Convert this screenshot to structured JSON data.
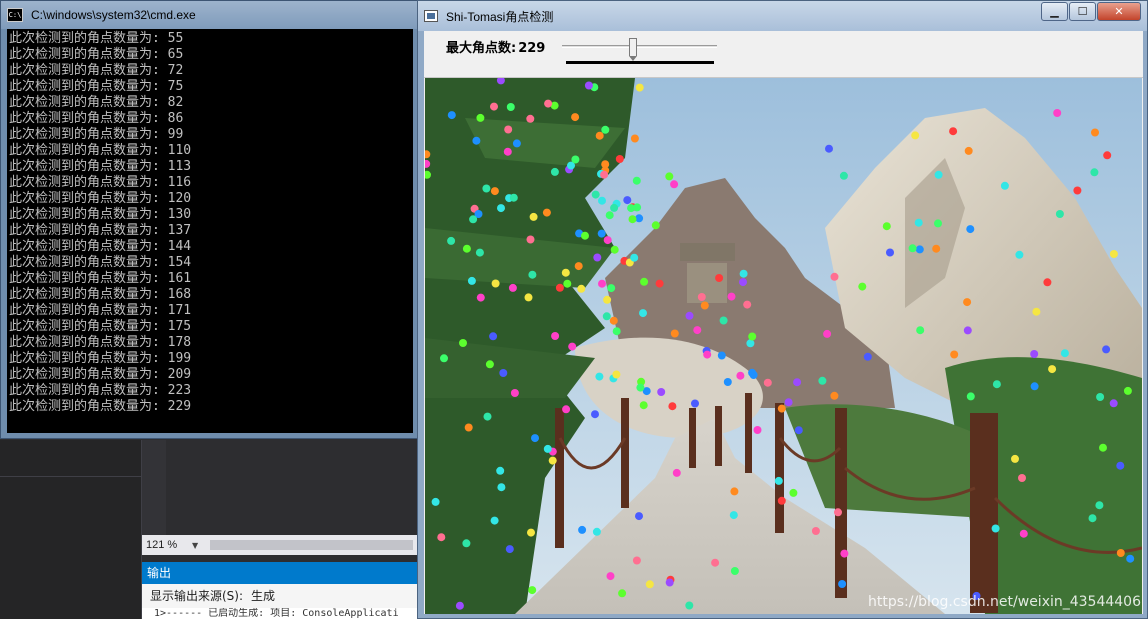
{
  "ide": {
    "zoom": "121 %",
    "output_panel_title": "输出",
    "show_output_from_label": "显示输出来源(S):",
    "show_output_from_value": "生成",
    "output_text": "1>------ 已启动生成: 项目: ConsoleApplicati"
  },
  "cmd": {
    "title": "C:\\windows\\system32\\cmd.exe",
    "icon": "cmd-icon",
    "lines": [
      "此次检测到的角点数量为: 55",
      "此次检测到的角点数量为: 65",
      "此次检测到的角点数量为: 72",
      "此次检测到的角点数量为: 75",
      "此次检测到的角点数量为: 82",
      "此次检测到的角点数量为: 86",
      "此次检测到的角点数量为: 99",
      "此次检测到的角点数量为: 110",
      "此次检测到的角点数量为: 113",
      "此次检测到的角点数量为: 116",
      "此次检测到的角点数量为: 120",
      "此次检测到的角点数量为: 130",
      "此次检测到的角点数量为: 137",
      "此次检测到的角点数量为: 144",
      "此次检测到的角点数量为: 154",
      "此次检测到的角点数量为: 161",
      "此次检测到的角点数量为: 168",
      "此次检测到的角点数量为: 171",
      "此次检测到的角点数量为: 175",
      "此次检测到的角点数量为: 178",
      "此次检测到的角点数量为: 199",
      "此次检测到的角点数量为: 209",
      "此次检测到的角点数量为: 223",
      "此次检测到的角点数量为: 229"
    ]
  },
  "cv_window": {
    "title": "Shi-Tomasi角点检测",
    "minimize_icon": "minimize-icon",
    "maximize_icon": "maximize-icon",
    "close_icon": "close-icon",
    "trackbar_label": "最大角点数:",
    "trackbar_value": "229",
    "trackbar_fraction": 0.46,
    "watermark": "https://blog.csdn.net/weixin_43544406",
    "image_subject": "mountain-path-image"
  },
  "colors": {
    "cmd_bg": "#000000",
    "cmd_text": "#c0c0c0",
    "ide_accent": "#007acc"
  }
}
